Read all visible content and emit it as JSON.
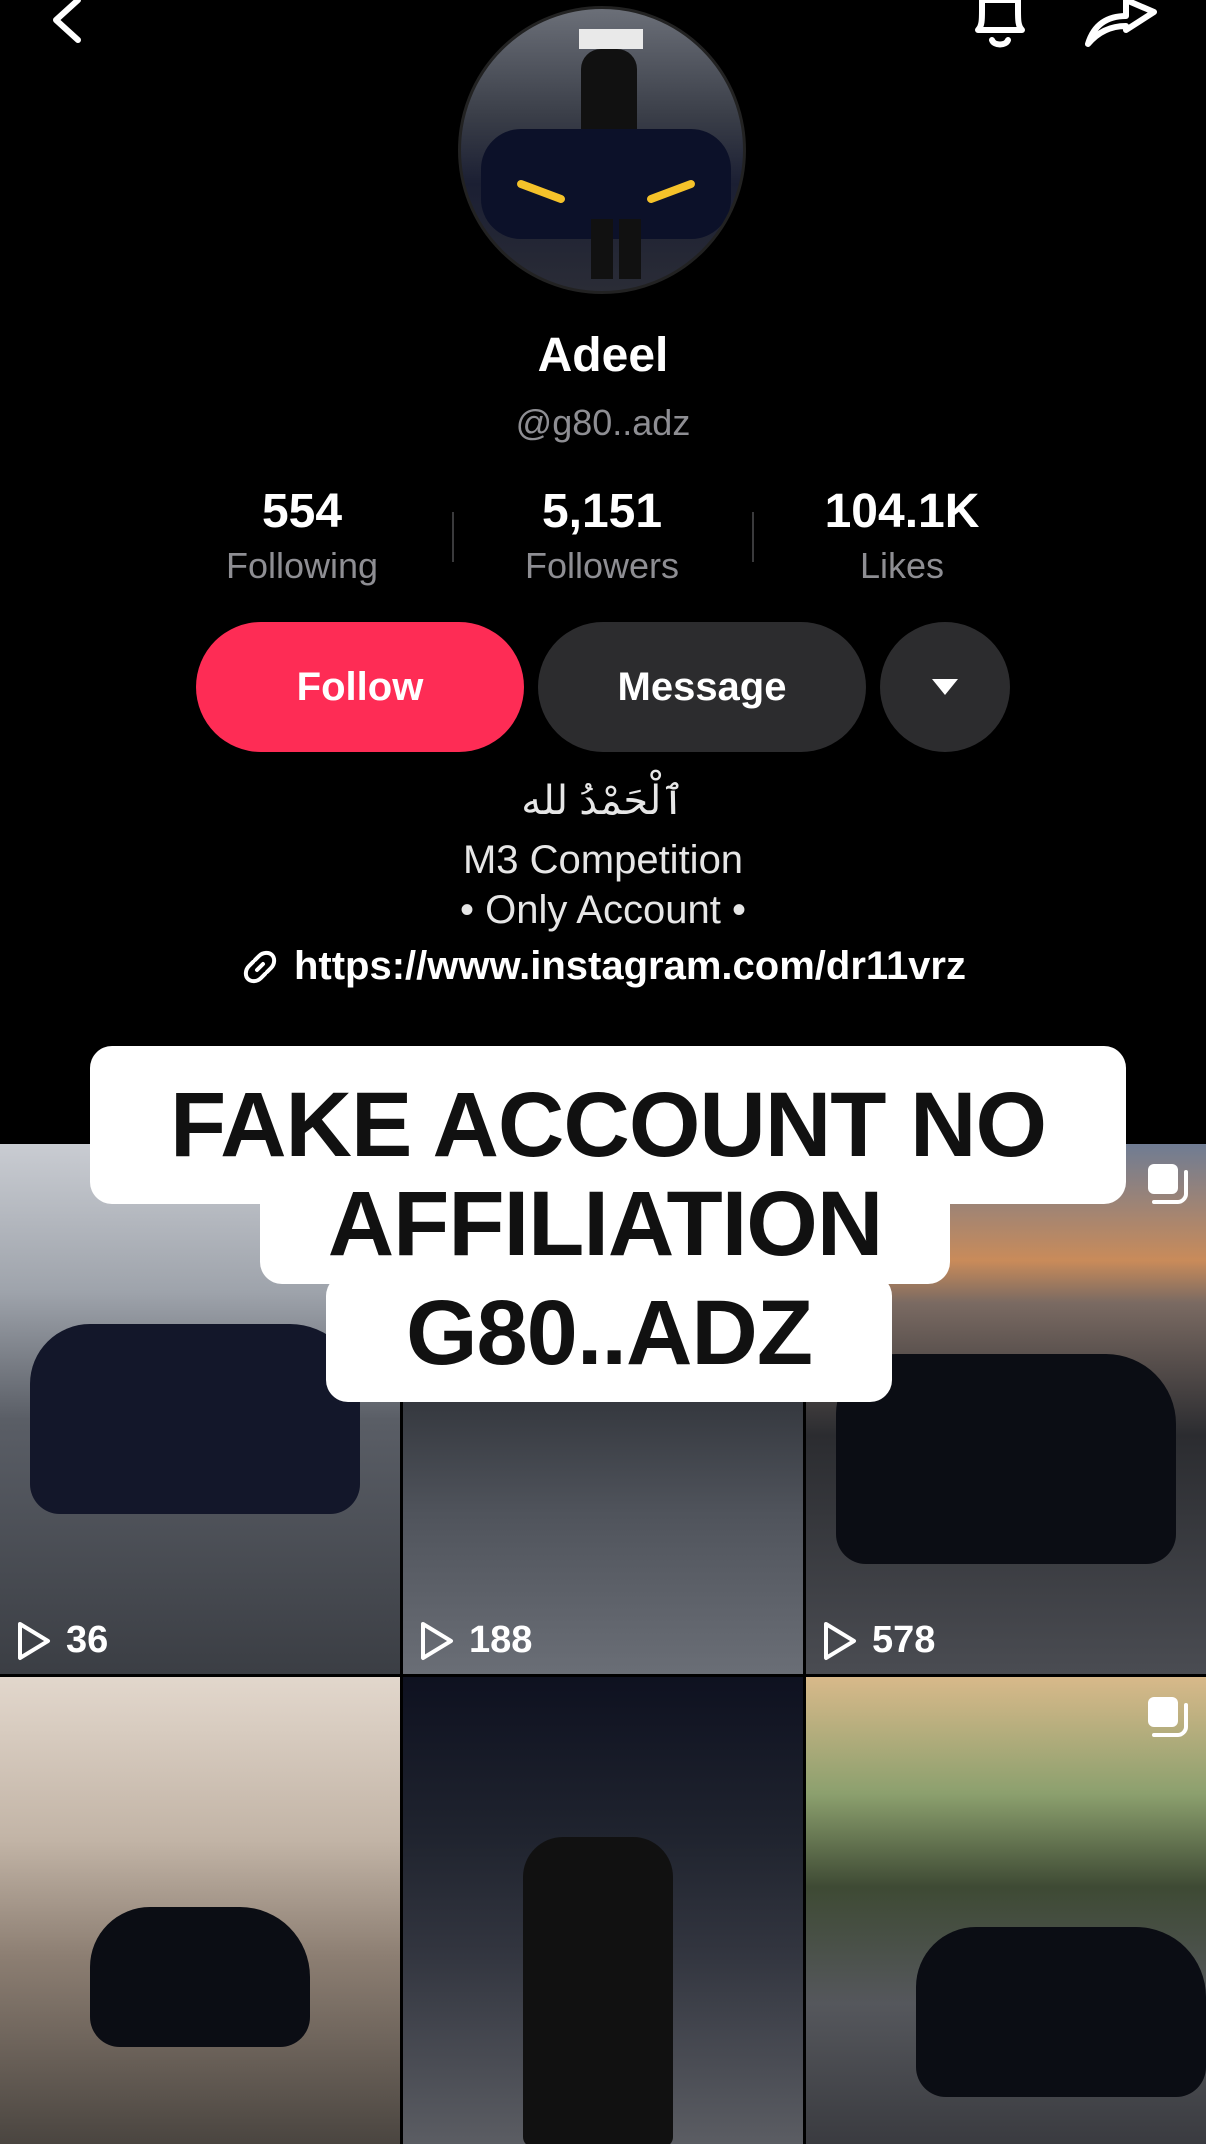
{
  "profile": {
    "name": "Adeel",
    "handle": "@g80..adz",
    "stats": [
      {
        "value": "554",
        "label": "Following"
      },
      {
        "value": "5,151",
        "label": "Followers"
      },
      {
        "value": "104.1K",
        "label": "Likes"
      }
    ],
    "actions": {
      "follow_label": "Follow",
      "message_label": "Message"
    },
    "bio": {
      "arabic": "ٱلْحَمْدُ لله",
      "line1": "M3 Competition",
      "line2": "• Only Account •",
      "link": "https://www.instagram.com/dr11vrz"
    }
  },
  "overlay_text": {
    "line1": "FAKE ACCOUNT NO",
    "line2": "AFFILIATION",
    "line3": "G80..ADZ"
  },
  "videos": [
    {
      "plays": "36"
    },
    {
      "plays": "188"
    },
    {
      "plays": "578"
    },
    {
      "multi": true
    },
    {},
    {
      "multi": true
    }
  ],
  "colors": {
    "follow_button": "#fe2c55",
    "secondary_button": "#2c2c2e",
    "muted_text": "#8e8e93",
    "background": "#000000"
  },
  "icons": [
    "back-icon",
    "bell-icon",
    "share-icon",
    "dropdown-icon",
    "link-icon",
    "play-icon",
    "multi-photo-icon"
  ]
}
